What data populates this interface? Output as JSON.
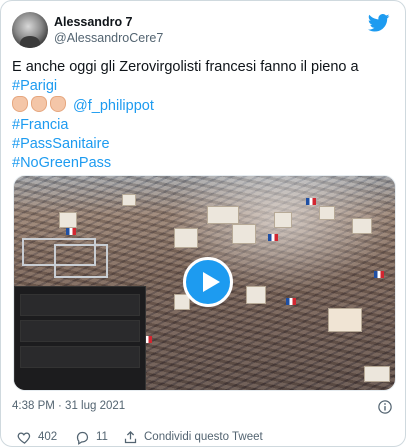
{
  "author": {
    "display_name": "Alessandro 7",
    "handle": "@AlessandroCere7",
    "avatar_icon": "avatar"
  },
  "brand": {
    "logo_icon": "twitter-bird-icon",
    "color": "#1d9bf0"
  },
  "tweet": {
    "line1": "E anche oggi gli Zerovirgolisti francesi fanno il pieno a",
    "hashtag_parigi": "#Parigi",
    "mention": "@f_philippot",
    "hashtag_francia": "#Francia",
    "hashtag_pass": "#PassSanitaire",
    "hashtag_nogreen": "#NoGreenPass",
    "emoji": [
      "clapping-hands",
      "clapping-hands",
      "clapping-hands"
    ]
  },
  "media": {
    "type": "video",
    "play_icon": "play-icon"
  },
  "meta": {
    "timestamp": "4:38 PM · 31 lug 2021",
    "info_icon": "info-icon"
  },
  "actions": {
    "like_count": "402",
    "reply_count": "11",
    "share_label": "Condividi questo Tweet"
  },
  "colors": {
    "text": "#0f1419",
    "secondary": "#536471",
    "link": "#1d9bf0",
    "border": "#cfd9de"
  }
}
